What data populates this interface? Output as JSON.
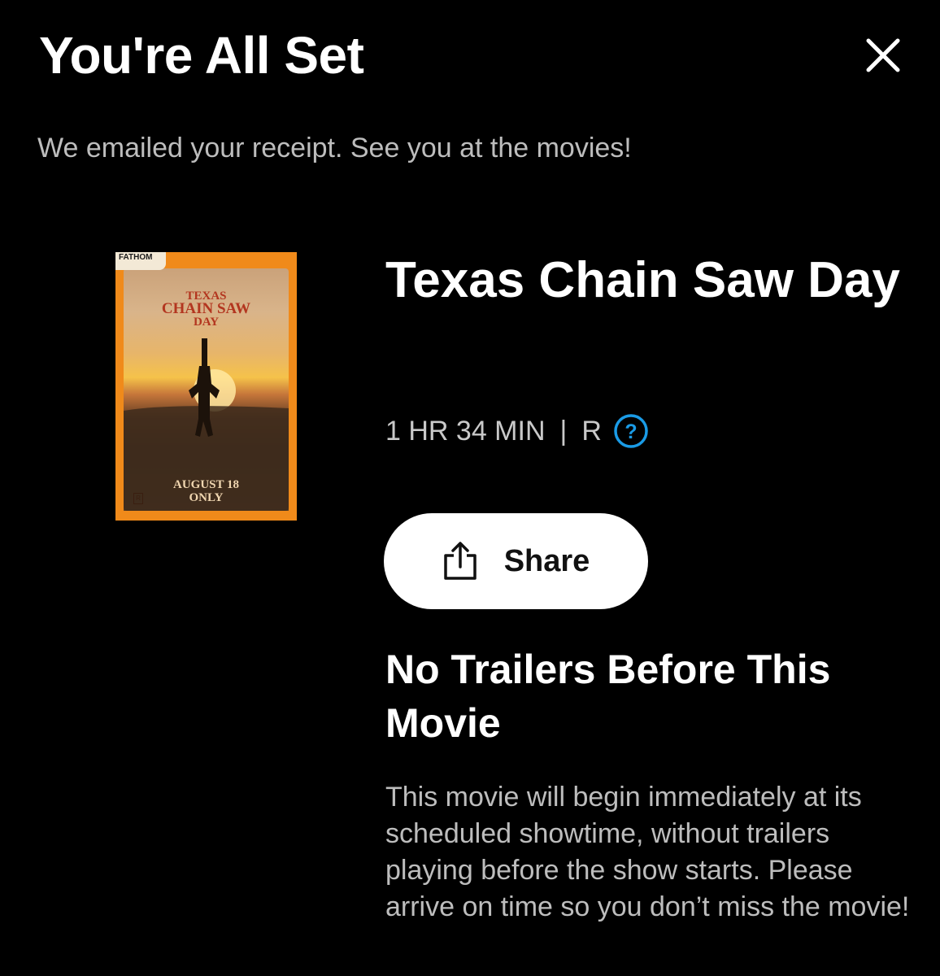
{
  "header": {
    "title": "You're All Set",
    "close_icon": "close-icon"
  },
  "confirmation": {
    "message": "We emailed your receipt. See you at the movies!"
  },
  "poster": {
    "brand": "FATHOM",
    "title_line1": "TEXAS",
    "title_line2": "CHAIN SAW",
    "title_line3": "DAY",
    "date_line1": "AUGUST 18",
    "date_line2": "ONLY",
    "rating_mark": "R",
    "background_color": "#f08a1a"
  },
  "movie": {
    "title": "Texas Chain Saw Day",
    "runtime": "1 HR 34 MIN",
    "separator": "|",
    "rating": "R",
    "rating_help_icon": "question-circle-icon",
    "rating_help_color": "#1a9be6"
  },
  "actions": {
    "share_label": "Share",
    "share_icon": "share-icon"
  },
  "trailers_notice": {
    "heading": "No Trailers Before This Movie",
    "body": "This movie will begin immediately at its scheduled showtime, without trailers playing before the show starts. Please arrive on time so you don’t miss the movie!"
  },
  "colors": {
    "background": "#000000",
    "text_primary": "#ffffff",
    "text_secondary": "#bdbdbd",
    "button_bg": "#ffffff"
  }
}
